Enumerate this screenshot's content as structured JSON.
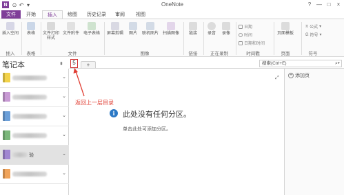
{
  "app_title": "OneNote",
  "window_controls": {
    "help": "?",
    "minimize": "—",
    "maximize": "□",
    "close": "×"
  },
  "tabs": [
    "文件",
    "开始",
    "插入",
    "绘图",
    "历史记录",
    "审阅",
    "视图"
  ],
  "active_tab": "插入",
  "ribbon": {
    "groups": [
      {
        "label": "插入",
        "buttons": [
          "插入空间"
        ]
      },
      {
        "label": "表格",
        "buttons": [
          "表格"
        ]
      },
      {
        "label": "文件",
        "buttons": [
          "文件打印样式",
          "文件附件",
          "电子表格"
        ]
      },
      {
        "label": "图像",
        "buttons": [
          "屏幕剪辑",
          "图片",
          "联机图片",
          "扫描图像"
        ]
      },
      {
        "label": "链接",
        "buttons": [
          "链接"
        ]
      },
      {
        "label": "正在录制",
        "buttons": [
          "录音",
          "录像"
        ]
      },
      {
        "label": "时间戳",
        "buttons": [
          "日期",
          "时间",
          "日期和时间"
        ]
      },
      {
        "label": "页面",
        "buttons": [
          "页面模板"
        ]
      },
      {
        "label": "符号",
        "buttons": [
          "公式",
          "符号"
        ]
      }
    ]
  },
  "left_pane": {
    "title": "笔记本",
    "pin": "⇞",
    "notebooks": [
      {
        "color": "#f2d249",
        "label": ""
      },
      {
        "color": "#c89ad4",
        "label": ""
      },
      {
        "color": "#6b9fd9",
        "label": ""
      },
      {
        "color": "#7ab77a",
        "label": ""
      },
      {
        "color": "#e47a7a",
        "label": ""
      },
      {
        "color": "#f0a35a",
        "label": ""
      },
      {
        "color": "#a086d1",
        "label": "验"
      }
    ]
  },
  "section_bar": {
    "back_label": "5",
    "add_tab": "+"
  },
  "search": {
    "placeholder": "搜索(Ctrl+E)"
  },
  "annotation": "返回上一层目录",
  "main": {
    "info_icon": "i",
    "title": "此处没有任何分区。",
    "subtitle": "单击此处可添加分区。"
  },
  "right_pane": {
    "add_page": "添加页"
  },
  "colors": {
    "accent": "#7f3e98",
    "annotation": "#e03c31",
    "info": "#2b78c5"
  }
}
